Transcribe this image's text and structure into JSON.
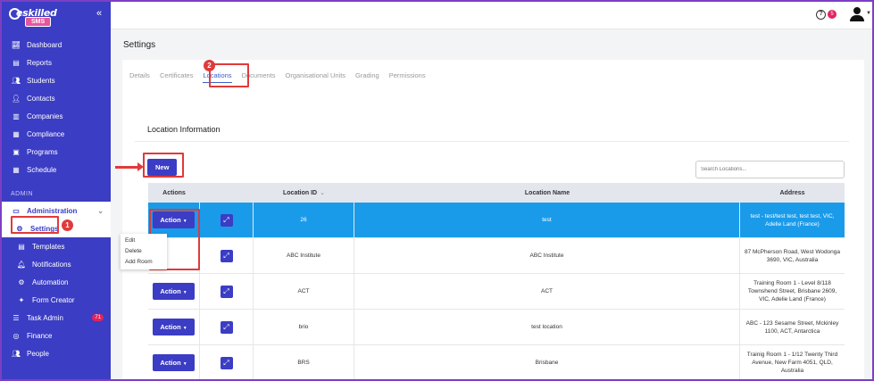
{
  "app": {
    "logo_top": "eskilled",
    "logo_bottom": "SMS"
  },
  "sidebar": {
    "items": [
      {
        "label": "Dashboard",
        "icon": "chart-line-icon"
      },
      {
        "label": "Reports",
        "icon": "report-icon"
      },
      {
        "label": "Students",
        "icon": "students-icon"
      },
      {
        "label": "Contacts",
        "icon": "contacts-icon"
      },
      {
        "label": "Companies",
        "icon": "building-icon"
      },
      {
        "label": "Compliance",
        "icon": "compliance-icon"
      },
      {
        "label": "Programs",
        "icon": "programs-icon"
      },
      {
        "label": "Schedule",
        "icon": "calendar-icon"
      }
    ],
    "admin_section": "ADMIN",
    "administration": "Administration",
    "settings": "Settings",
    "sub_items": [
      {
        "label": "Templates",
        "icon": "template-icon"
      },
      {
        "label": "Notifications",
        "icon": "bell-icon"
      },
      {
        "label": "Automation",
        "icon": "gear-icon"
      },
      {
        "label": "Form Creator",
        "icon": "wand-icon"
      }
    ],
    "task_admin": "Task Admin",
    "task_admin_badge": "71",
    "finance": "Finance",
    "people": "People"
  },
  "topbar": {
    "help": "?",
    "notifications_count": "5"
  },
  "page": {
    "title": "Settings",
    "tabs": [
      "Details",
      "Certificates",
      "Locations",
      "Documents",
      "Organisational Units",
      "Grading",
      "Permissions"
    ],
    "active_tab": "Locations",
    "section_title": "Location Information",
    "new_button": "New",
    "search_placeholder": "Search Locations..."
  },
  "table": {
    "headers": {
      "actions": "Actions",
      "location_id": "Location ID",
      "location_name": "Location Name",
      "address": "Address"
    },
    "action_label": "Action",
    "rows": [
      {
        "id": "26",
        "name": "test",
        "address": "test - test/test test, test test, VIC, Adelie Land (France)",
        "selected": true
      },
      {
        "id": "ABC Institute",
        "name": "ABC Institute",
        "address": "87 McPherson Road, West Wodonga 3690, VIC, Australia"
      },
      {
        "id": "ACT",
        "name": "ACT",
        "address": "Training Room 1 - Level 8/118 Townshend Street, Brisbane 2609, VIC, Adelie Land (France)"
      },
      {
        "id": "brio",
        "name": "test location",
        "address": "ABC - 123 Sesame Street, Mckinley 1100, ACT, Antarctica"
      },
      {
        "id": "BRS",
        "name": "Brisbane",
        "address": "Trainig Room 1 - 1/12 Twenty Third Avenue, New Farm 4051, QLD, Australia"
      }
    ]
  },
  "dropdown": {
    "items": [
      "Edit",
      "Delete",
      "Add Room"
    ]
  },
  "annotations": {
    "step1": "1",
    "step2": "2"
  },
  "colors": {
    "sidebar": "#3b3dc4",
    "accent": "#3b3dc4",
    "selected_row": "#1a9bea",
    "annotation": "#e03a3a"
  }
}
